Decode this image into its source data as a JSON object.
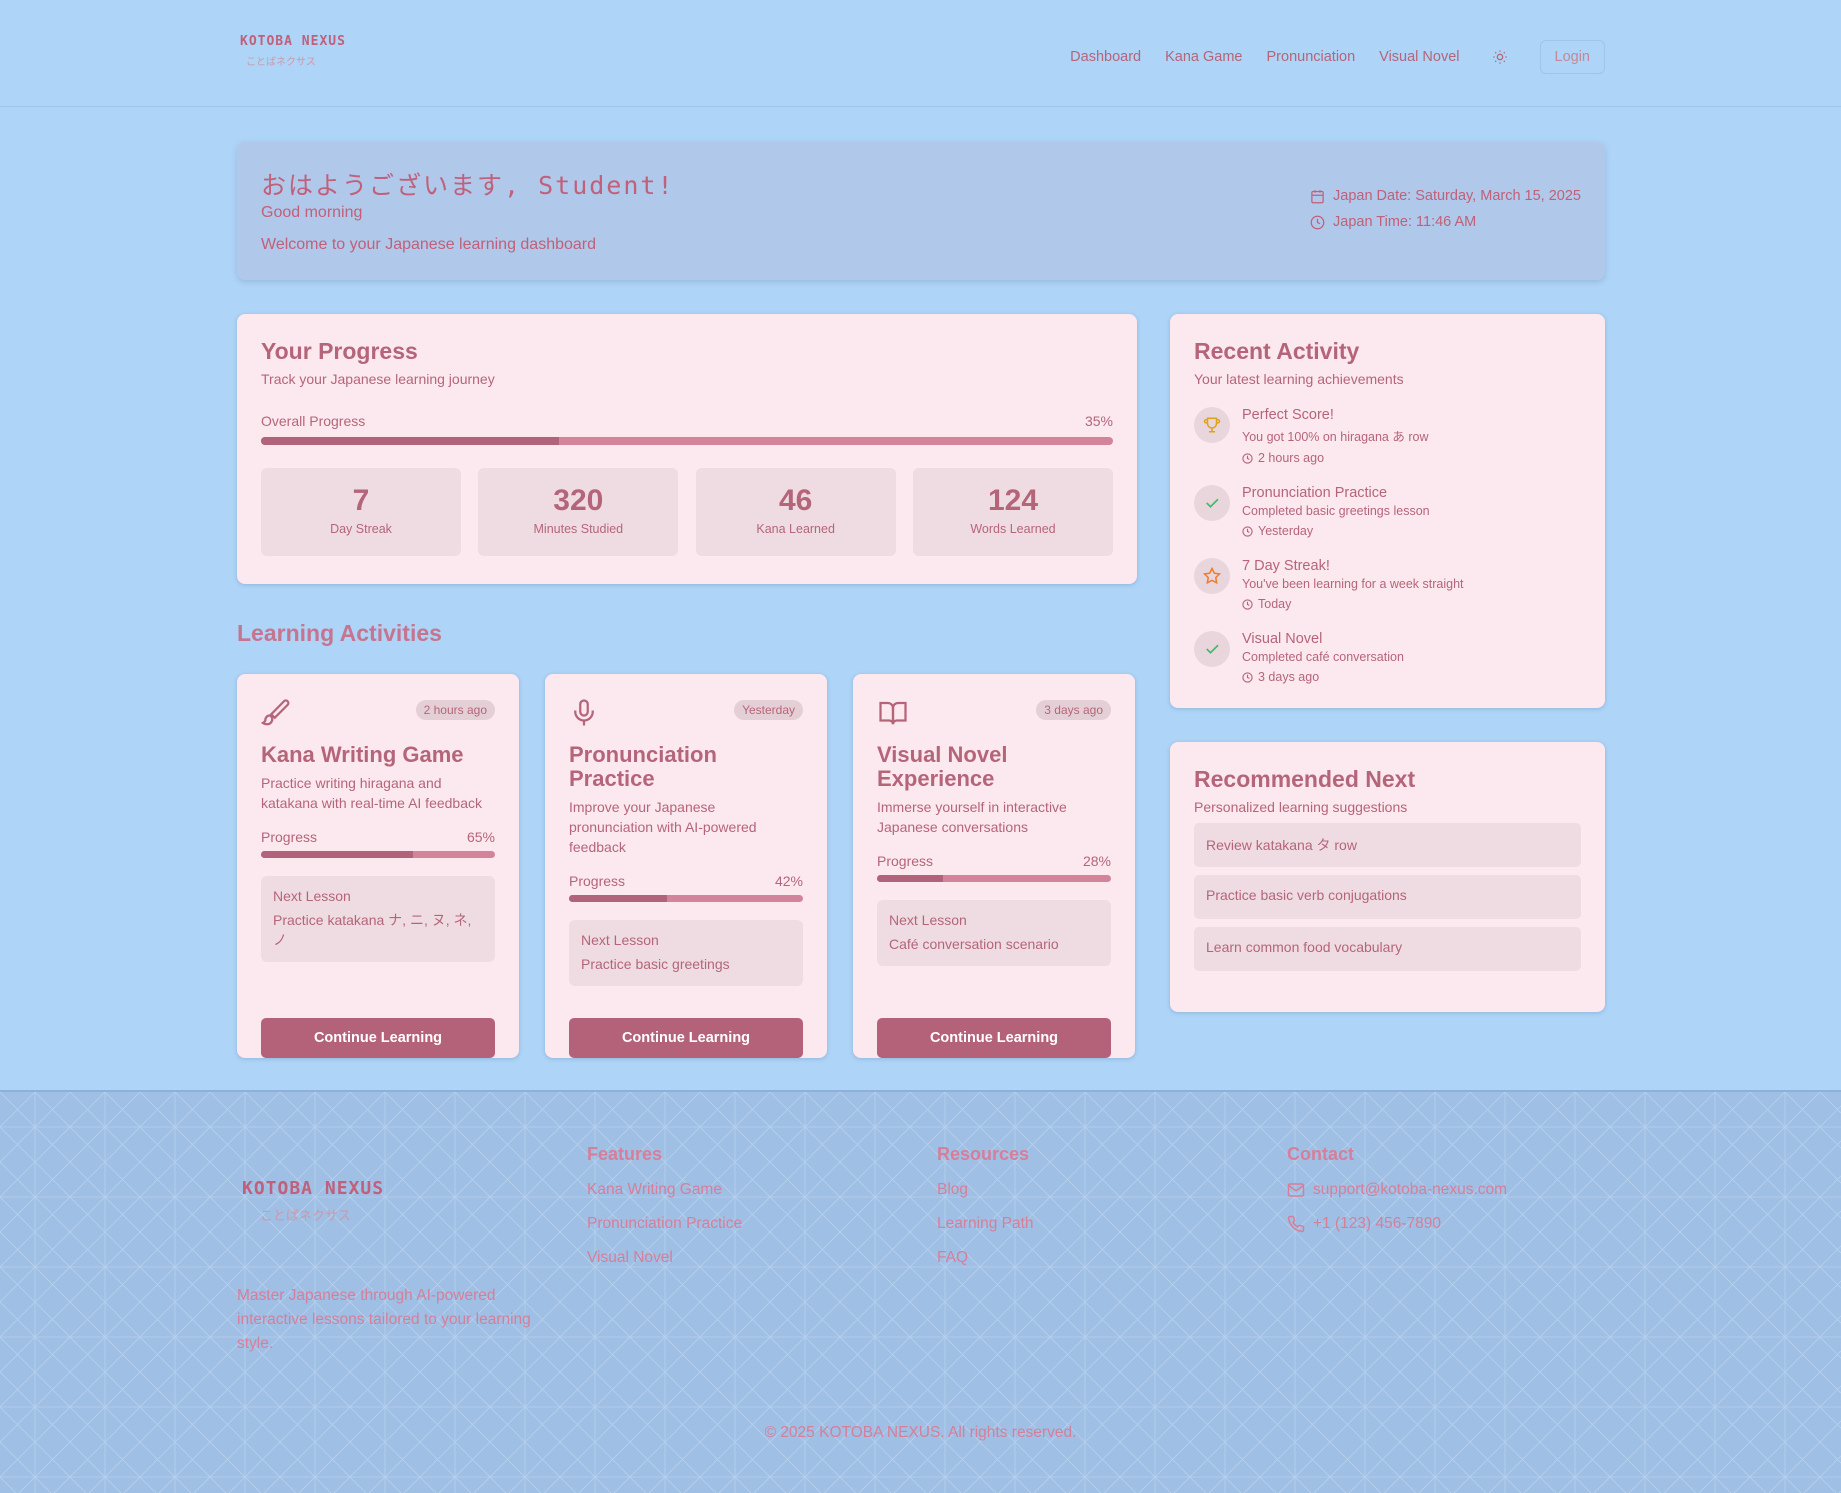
{
  "brand": {
    "name": "KOTOBA NEXUS",
    "jp": "ことばネクサス"
  },
  "nav": {
    "items": [
      "Dashboard",
      "Kana Game",
      "Pronunciation",
      "Visual Novel"
    ],
    "login": "Login"
  },
  "welcome": {
    "greeting_jp": "おはようございます, Student!",
    "greeting_en": "Good morning",
    "subtitle": "Welcome to your Japanese learning dashboard",
    "date": "Japan Date: Saturday, March 15, 2025",
    "time": "Japan Time: 11:46 AM"
  },
  "progress": {
    "title": "Your Progress",
    "subtitle": "Track your Japanese learning journey",
    "overall_label": "Overall Progress",
    "overall_value": "35%",
    "overall_fraction": 0.35,
    "stats": [
      {
        "value": "7",
        "label": "Day Streak"
      },
      {
        "value": "320",
        "label": "Minutes Studied"
      },
      {
        "value": "46",
        "label": "Kana Learned"
      },
      {
        "value": "124",
        "label": "Words Learned"
      }
    ]
  },
  "activities": {
    "title": "Learning Activities",
    "progress_label": "Progress",
    "next_label": "Next Lesson",
    "cta": "Continue Learning",
    "items": [
      {
        "icon": "brush-icon",
        "badge": "2 hours ago",
        "title": "Kana Writing Game",
        "desc": "Practice writing hiragana and katakana with real-time AI feedback",
        "progress": "65%",
        "fraction": 0.65,
        "next": "Practice katakana ナ, ニ, ヌ, ネ, ノ"
      },
      {
        "icon": "microphone-icon",
        "badge": "Yesterday",
        "title": "Pronunciation Practice",
        "desc": "Improve your Japanese pronunciation with AI-powered feedback",
        "progress": "42%",
        "fraction": 0.42,
        "next": "Practice basic greetings"
      },
      {
        "icon": "book-icon",
        "badge": "3 days ago",
        "title": "Visual Novel Experience",
        "desc": "Immerse yourself in interactive Japanese conversations",
        "progress": "28%",
        "fraction": 0.28,
        "next": "Café conversation scenario"
      }
    ]
  },
  "recent": {
    "title": "Recent Activity",
    "subtitle": "Your latest learning achievements",
    "items": [
      {
        "icon": "trophy-icon",
        "title": "Perfect Score!",
        "desc": "You got 100% on hiragana あ row",
        "time": "2 hours ago"
      },
      {
        "icon": "check-icon",
        "title": "Pronunciation Practice",
        "desc": "Completed basic greetings lesson",
        "time": "Yesterday"
      },
      {
        "icon": "star-icon",
        "title": "7 Day Streak!",
        "desc": "You've been learning for a week straight",
        "time": "Today"
      },
      {
        "icon": "check-icon",
        "title": "Visual Novel",
        "desc": "Completed café conversation",
        "time": "3 days ago"
      }
    ]
  },
  "recommended": {
    "title": "Recommended Next",
    "subtitle": "Personalized learning suggestions",
    "items": [
      "Review katakana タ row",
      "Practice basic verb conjugations",
      "Learn common food vocabulary"
    ]
  },
  "footer": {
    "description": "Master Japanese through AI-powered interactive lessons tailored to your learning style.",
    "features": {
      "title": "Features",
      "links": [
        "Kana Writing Game",
        "Pronunciation Practice",
        "Visual Novel"
      ]
    },
    "resources": {
      "title": "Resources",
      "links": [
        "Blog",
        "Learning Path",
        "FAQ"
      ]
    },
    "contact": {
      "title": "Contact",
      "email": "support@kotoba-nexus.com",
      "phone": "+1 (123) 456-7890"
    },
    "copyright": "© 2025 KOTOBA NEXUS. All rights reserved."
  },
  "colors": {
    "background": "#aed4f7",
    "card": "#fce8ef",
    "accent": "#b4627a",
    "footer": "#9fbfe4"
  }
}
